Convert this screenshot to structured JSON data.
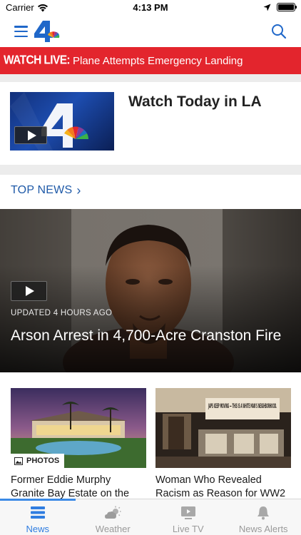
{
  "status_bar": {
    "carrier": "Carrier",
    "time": "4:13 PM"
  },
  "header": {
    "logo_icon": "nbc4-logo",
    "menu_icon": "hamburger-menu-icon",
    "search_icon": "search-icon"
  },
  "live_banner": {
    "label": "WATCH LIVE:",
    "text": "Plane Attempts Emergency Landing",
    "color": "#e3252d"
  },
  "watch_today": {
    "title": "Watch Today in LA"
  },
  "top_news": {
    "label": "TOP NEWS",
    "chevron": "›"
  },
  "hero": {
    "updated": "UPDATED 4 HOURS AGO",
    "headline": "Arson Arrest in 4,700-Acre Cranston Fire"
  },
  "cards": [
    {
      "badge": "PHOTOS",
      "headline": "Former Eddie Murphy Granite Bay Estate on the Marker for"
    },
    {
      "sign_text": "JAPS KEEP MOVING — THIS IS A WHITE MAN'S NEIGHBORHOOD.",
      "headline": "Woman Who Revealed Racism as Reason for WW2"
    }
  ],
  "tabs": [
    {
      "label": "News",
      "active": true
    },
    {
      "label": "Weather",
      "active": false
    },
    {
      "label": "Live TV",
      "active": false
    },
    {
      "label": "News Alerts",
      "active": false
    }
  ],
  "colors": {
    "accent": "#2f7de0",
    "link": "#1f5aa8",
    "banner_red": "#e3252d"
  }
}
